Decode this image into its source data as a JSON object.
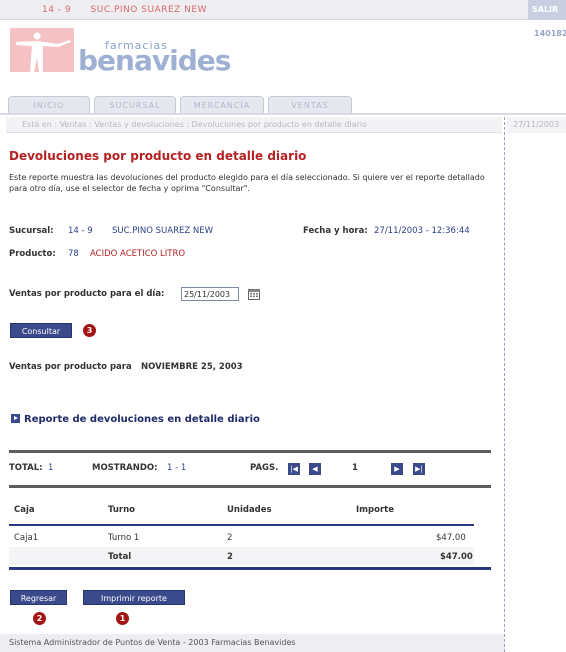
{
  "topbar": {
    "store_code": "14 - 9",
    "store_name": "SUC.PINO SUAREZ NEW",
    "exit_label": "SALIR"
  },
  "logo": {
    "small": "farmacias",
    "big": "benavides"
  },
  "right_code": "140182",
  "tabs": [
    {
      "label": "INICIO"
    },
    {
      "label": "SUCURSAL"
    },
    {
      "label": "MERCANCÍA"
    },
    {
      "label": "VENTAS"
    }
  ],
  "breadcrumb": "Está en : Ventas : Ventas y devoluciones : Devoluciones por producto en detalle diario",
  "header_date": "27/11/2003",
  "page": {
    "title": "Devoluciones por producto en detalle diario",
    "description": "Este reporte muestra las devoluciones del producto elegido para el día seleccionado. Si quiere ver el reporte detallado para otro día, use el selector de fecha y oprima \"Consultar\"."
  },
  "info": {
    "sucursal_label": "Sucursal:",
    "sucursal_code": "14 - 9",
    "sucursal_name": "SUC.PINO SUAREZ NEW",
    "fecha_label": "Fecha y hora:",
    "fecha_value": "27/11/2003 - 12:36:44",
    "producto_label": "Producto:",
    "producto_code": "78",
    "producto_name": "ACIDO ACETICO LITRO"
  },
  "form": {
    "date_label": "Ventas por producto para el día:",
    "date_value": "25/11/2003",
    "consultar_label": "Consultar",
    "consultar_badge": "3"
  },
  "report_date": {
    "label": "Ventas por producto para",
    "value": "NOVIEMBRE 25, 2003"
  },
  "report_link": "Reporte de devoluciones en detalle diario",
  "pager": {
    "total_label": "TOTAL:",
    "total_value": "1",
    "mostrando_label": "MOSTRANDO:",
    "mostrando_value": "1 - 1",
    "pags_label": "PAGS.",
    "current_page": "1"
  },
  "table": {
    "headers": [
      "Caja",
      "Turno",
      "Unidades",
      "Importe"
    ],
    "rows": [
      {
        "caja": "Caja1",
        "turno": "Turno 1",
        "unidades": "2",
        "importe": "$47.00"
      }
    ],
    "total": {
      "label": "Total",
      "unidades": "2",
      "importe": "$47.00"
    }
  },
  "buttons": {
    "regresar_label": "Regresar",
    "regresar_badge": "2",
    "imprimir_label": "Imprimir reporte",
    "imprimir_badge": "1"
  },
  "footer": "Sistema Administrador de Puntos de Venta - 2003 Farmacias Benavides",
  "colors": {
    "brand_blue": "#3a4a8a",
    "title_red": "#b52222",
    "link_blue": "#2d3f8a",
    "badge_red": "#a51414"
  }
}
